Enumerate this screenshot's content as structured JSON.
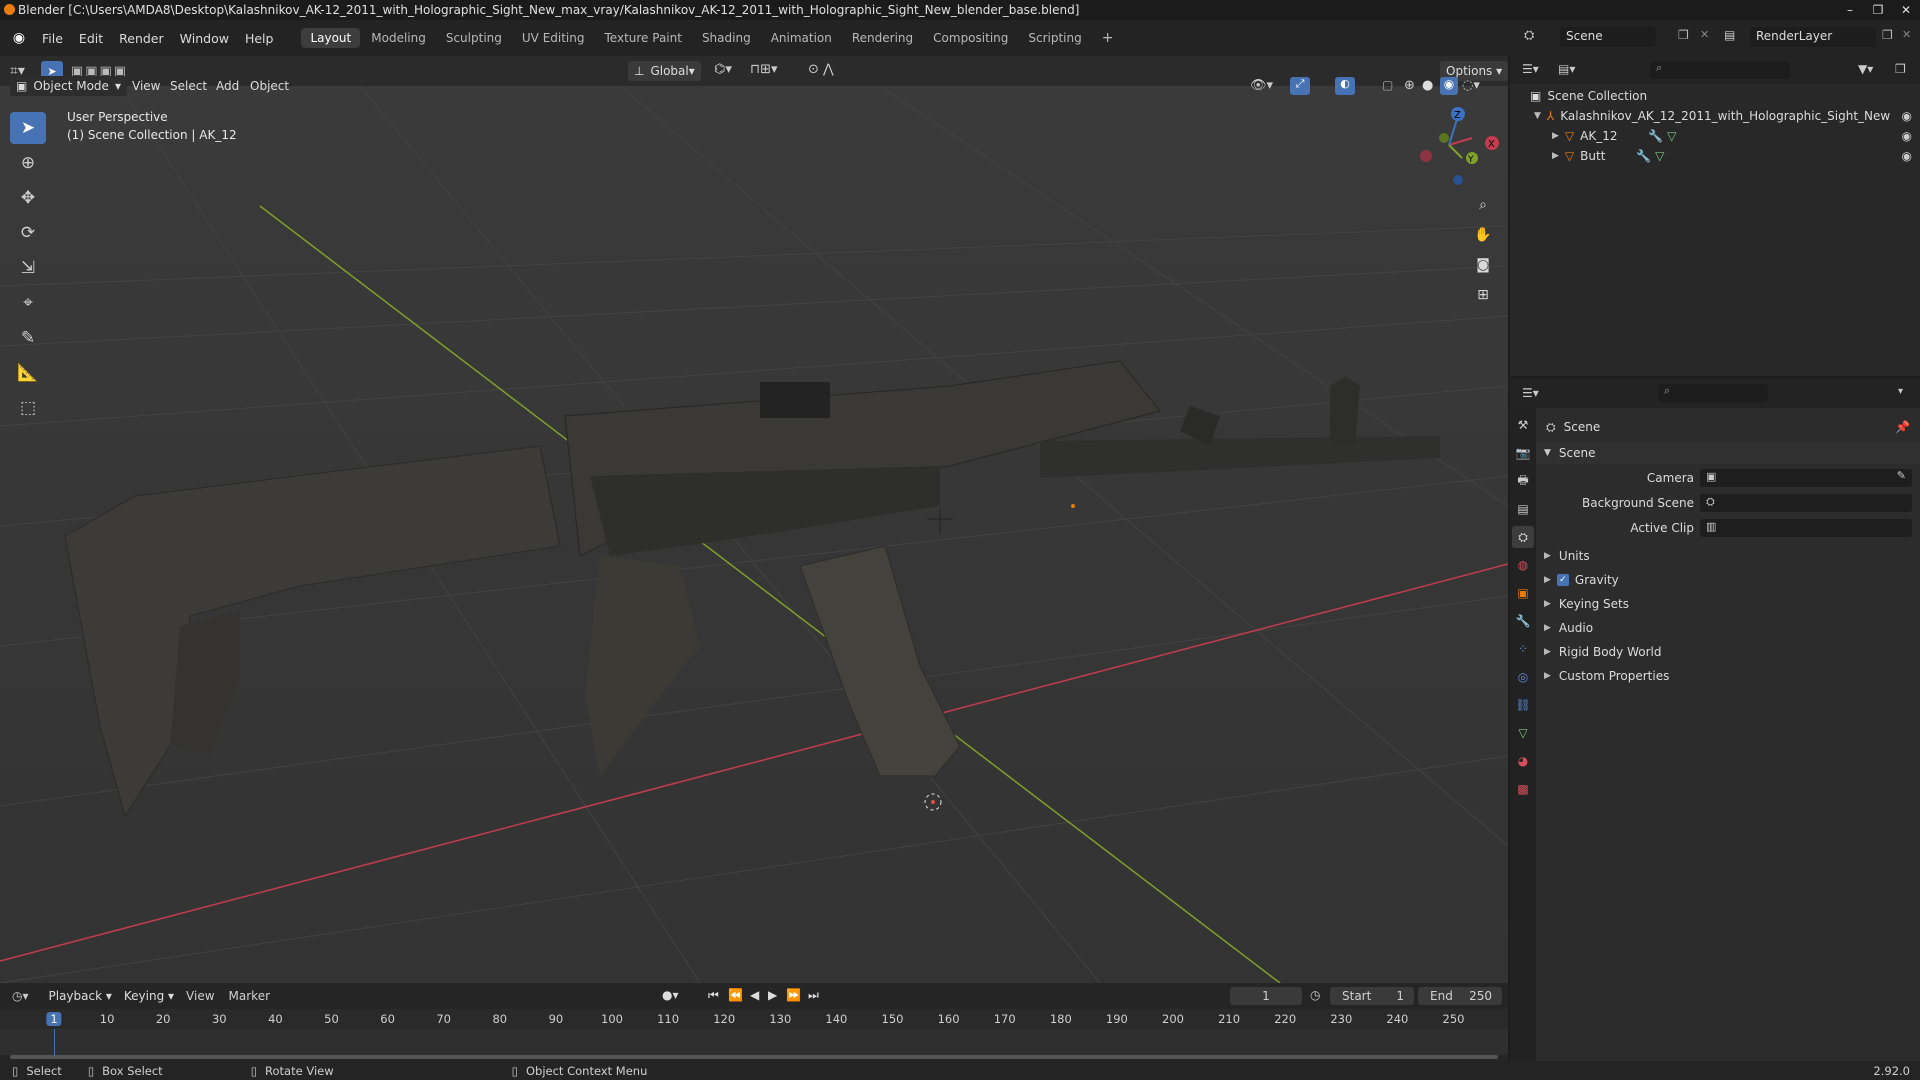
{
  "window": {
    "title": "Blender [C:\\Users\\AMDA8\\Desktop\\Kalashnikov_AK-12_2011_with_Holographic_Sight_New_max_vray/Kalashnikov_AK-12_2011_with_Holographic_Sight_New_blender_base.blend]"
  },
  "menus": [
    "File",
    "Edit",
    "Render",
    "Window",
    "Help"
  ],
  "workspaces": [
    {
      "label": "Layout",
      "active": true
    },
    {
      "label": "Modeling"
    },
    {
      "label": "Sculpting"
    },
    {
      "label": "UV Editing"
    },
    {
      "label": "Texture Paint"
    },
    {
      "label": "Shading"
    },
    {
      "label": "Animation"
    },
    {
      "label": "Rendering"
    },
    {
      "label": "Compositing"
    },
    {
      "label": "Scripting"
    }
  ],
  "header3d": {
    "mode": "Object Mode",
    "menu": [
      "View",
      "Select",
      "Add",
      "Object"
    ],
    "orientation": "Global",
    "options": "Options"
  },
  "viewport": {
    "perspective": "User Perspective",
    "collection": "(1) Scene Collection | AK_12",
    "gizmo_axes": {
      "x": "X",
      "y": "Y",
      "z": "Z"
    }
  },
  "scene_selector": {
    "label": "Scene",
    "renderlayer": "RenderLayer"
  },
  "outliner": {
    "root": "Scene Collection",
    "collection": "Kalashnikov_AK_12_2011_with_Holographic_Sight_New",
    "objects": [
      "AK_12",
      "Butt"
    ]
  },
  "properties": {
    "context": "Scene",
    "panel": "Scene",
    "fields": [
      {
        "label": "Camera"
      },
      {
        "label": "Background Scene"
      },
      {
        "label": "Active Clip"
      }
    ],
    "sections": [
      {
        "label": "Units",
        "checkbox": false
      },
      {
        "label": "Gravity",
        "checkbox": true
      },
      {
        "label": "Keying Sets",
        "checkbox": false
      },
      {
        "label": "Audio",
        "checkbox": false
      },
      {
        "label": "Rigid Body World",
        "checkbox": false
      },
      {
        "label": "Custom Properties",
        "checkbox": false
      }
    ]
  },
  "timeline": {
    "menu": [
      "Playback",
      "Keying",
      "View",
      "Marker"
    ],
    "current_frame": "1",
    "start_label": "Start",
    "start": "1",
    "end_label": "End",
    "end": "250",
    "ticks": [
      "1",
      "10",
      "20",
      "30",
      "40",
      "50",
      "60",
      "70",
      "80",
      "90",
      "100",
      "110",
      "120",
      "130",
      "140",
      "150",
      "160",
      "170",
      "180",
      "190",
      "200",
      "210",
      "220",
      "230",
      "240",
      "250"
    ]
  },
  "statusbar": {
    "select": "Select",
    "box_select": "Box Select",
    "rotate": "Rotate View",
    "context_menu": "Object Context Menu",
    "version": "2.92.0"
  },
  "colors": {
    "accent": "#4772b3",
    "x_axis": "#c43c4e",
    "y_axis": "#7fa02a",
    "z_axis": "#3b72c4",
    "orange": "#e87d0d"
  }
}
